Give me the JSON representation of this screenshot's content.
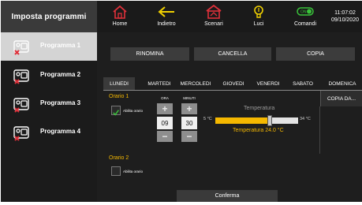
{
  "sidebar": {
    "title": "Imposta programmi",
    "items": [
      {
        "label": "Programma 1",
        "active": true
      },
      {
        "label": "Programma 2",
        "active": false
      },
      {
        "label": "Programma 3",
        "active": false
      },
      {
        "label": "Programma 4",
        "active": false
      }
    ]
  },
  "topbar": {
    "home": "Home",
    "back": "Indietro",
    "scenes": "Scenari",
    "lights": "Luci",
    "commands": "Comandi",
    "toggle_text": "ON",
    "time": "11:07:02",
    "date": "09/10/2020"
  },
  "actions": {
    "rename": "RINOMINA",
    "delete": "CANCELLA",
    "copy": "COPIA"
  },
  "days": [
    "LUNEDI",
    "MARTEDI",
    "MERCOLEDI",
    "GIOVEDI",
    "VENERDI",
    "SABATO",
    "DOMENICA"
  ],
  "active_day": "LUNEDI",
  "copy_day": "COPIA DA...",
  "orario1": {
    "title": "Orario 1",
    "enable_label": "Abilita orario",
    "enabled": true,
    "hour_caption": "ORA",
    "minute_caption": "MINUTI",
    "hour": "09",
    "minute": "30",
    "temp_title": "Temperatura",
    "min_label": "5 °C",
    "max_label": "34 °C",
    "temp_value": "Temperatura 24.0 °C",
    "temp_fraction": 0.66
  },
  "orario2": {
    "title": "Orario 2",
    "enable_label": "Abilita orario",
    "enabled": false
  },
  "confirm": "Conferma",
  "colors": {
    "accent": "#f5b800",
    "home_icon": "#e0303a",
    "back_icon": "#f0d000",
    "scenes_icon": "#e0303a",
    "lights_icon": "#f0d000",
    "commands_icon": "#39c23a"
  }
}
